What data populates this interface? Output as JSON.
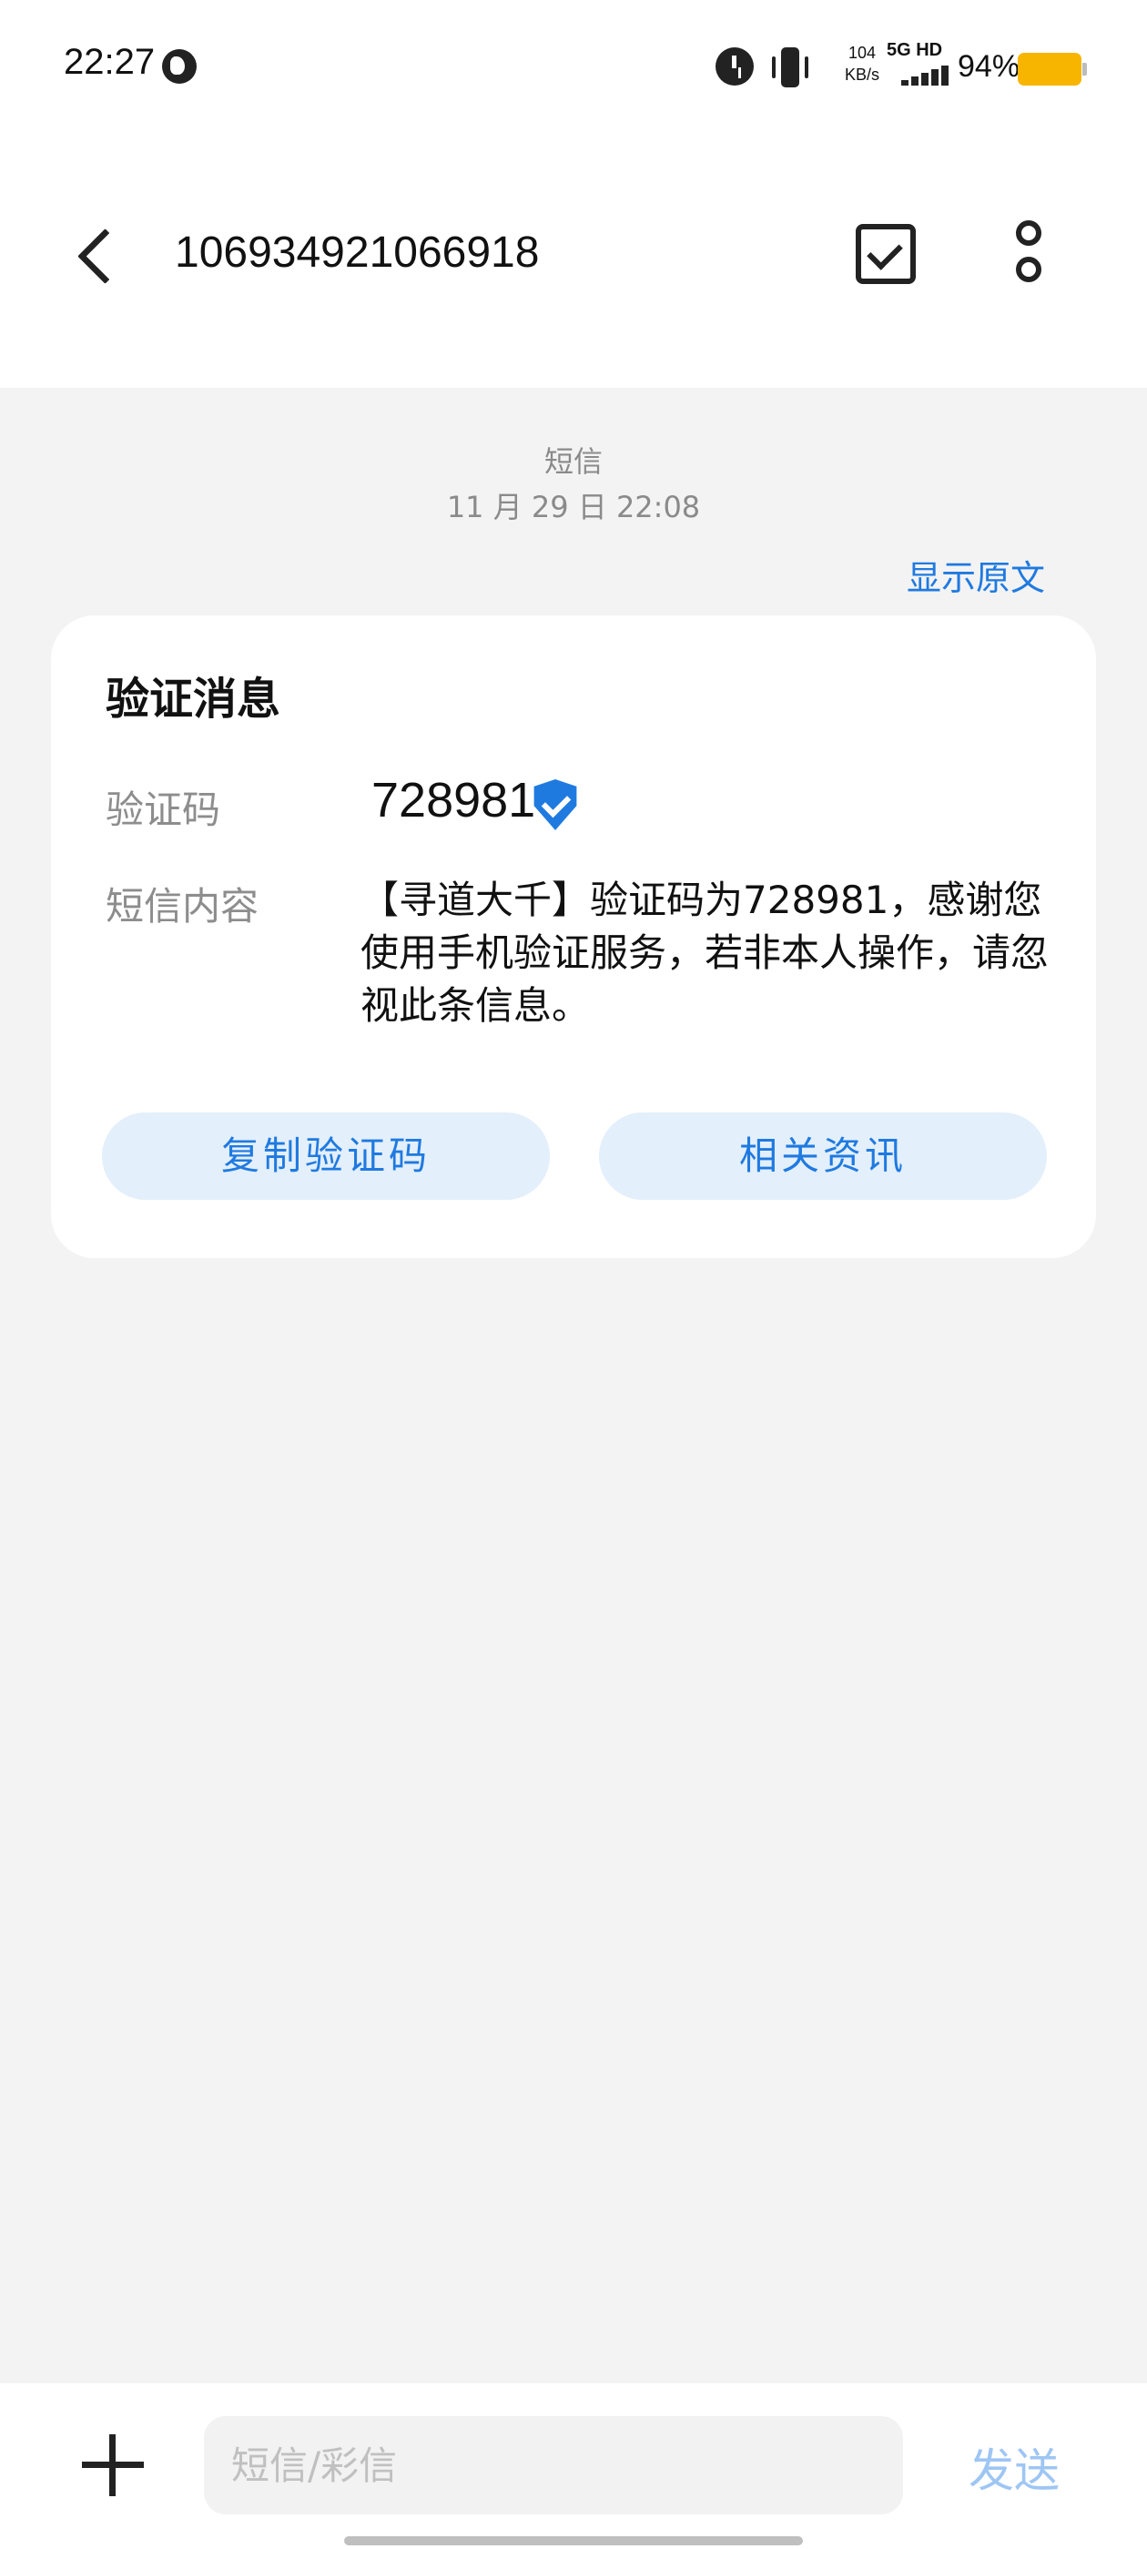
{
  "status_bar": {
    "time": "22:27",
    "speed_value": "104",
    "speed_unit": "KB/s",
    "network": "5G HD",
    "battery": "94%",
    "battery_color": "#f7b500"
  },
  "header": {
    "contact": "106934921066918",
    "back_icon": "chevron-left",
    "select_icon": "checkbox-square",
    "more_icon": "vertical-dots"
  },
  "message_meta": {
    "type": "短信",
    "time": "11 月 29 日 22:08",
    "show_original": "显示原文"
  },
  "card": {
    "title": "验证消息",
    "code_label": "验证码",
    "code_value": "728981",
    "content_label": "短信内容",
    "content": "【寻道大千】验证码为728981，感谢您使用手机验证服务，若非本人操作，请忽视此条信息。",
    "copy_button": "复制验证码",
    "related_button": "相关资讯"
  },
  "compose": {
    "placeholder": "短信/彩信",
    "send": "发送"
  },
  "colors": {
    "accent": "#1f7ae0",
    "button_bg": "#e3effb",
    "background": "#f3f3f3"
  }
}
